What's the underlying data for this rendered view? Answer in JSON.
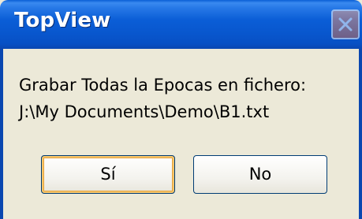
{
  "window": {
    "title": "TopView",
    "close_icon": "close-icon"
  },
  "message": {
    "line1": "Grabar Todas la Epocas en fichero:",
    "line2": "J:\\My Documents\\Demo\\B1.txt"
  },
  "buttons": {
    "yes_label": "Sí",
    "no_label": "No"
  },
  "colors": {
    "titlebar": "#0b5ed7",
    "dialog_bg": "#ece9d8",
    "close_button": "#d2826a"
  }
}
